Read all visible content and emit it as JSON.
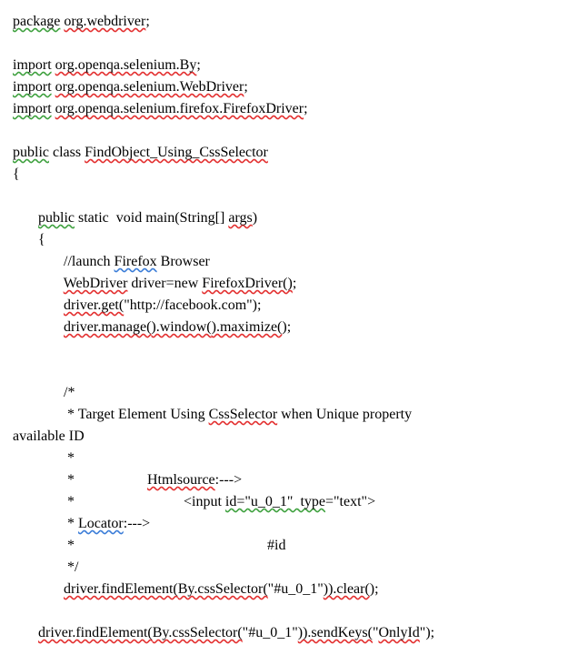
{
  "code": {
    "l1": {
      "a": "package",
      "b": " ",
      "c": "org.webdriver",
      "d": ";"
    },
    "l3": {
      "a": "import",
      "b": " ",
      "c": "org.openqa.selenium.By",
      "d": ";"
    },
    "l4": {
      "a": "import",
      "b": " ",
      "c": "org.openqa.selenium.WebDriver",
      "d": ";"
    },
    "l5": {
      "a": "import",
      "b": " ",
      "c": "org.openqa.selenium.firefox.FirefoxDriver",
      "d": ";"
    },
    "l7": {
      "a": "public",
      "b": " class ",
      "c": "FindObject_Using_CssSelector"
    },
    "l8": "{",
    "l10": {
      "a": "       ",
      "b": "public",
      "c": " static ",
      "c2": " void",
      "d": " main(String[] ",
      "e": "args",
      "f": ")"
    },
    "l11": "       {",
    "l12": {
      "a": "              //launch ",
      "b": "Firefox",
      "c": " Browser"
    },
    "l13": {
      "a": "              ",
      "b": "WebDriver",
      "c": " driver=new ",
      "d": "FirefoxDriver()",
      "e": ";"
    },
    "l14": {
      "a": "              ",
      "b": "driver.get(",
      "c": "\"http://facebook.com\"",
      "d": ");"
    },
    "l15": {
      "a": "              ",
      "b": "driver.manage(",
      "c": ").window(",
      "d": ").maximize(",
      "e": ");"
    },
    "l18": "              /*",
    "l19": {
      "a": "               * Target Element Using ",
      "b": "CssSelector",
      "c": " when Unique property"
    },
    "l20": "available ID",
    "l21": "               *",
    "l22": {
      "a": "               *                    ",
      "b": "Htmlsource",
      "c": ":--->"
    },
    "l23": {
      "a": "               *                              <input ",
      "b": "id=\"u_0_1\"  type",
      "c": "=\"text\">"
    },
    "l24": {
      "a": "               * ",
      "b": "Locator",
      "c": ":--->"
    },
    "l25": "               *                                                     #id",
    "l26": "               */",
    "l27": {
      "a": "              ",
      "b": "driver.findElement(",
      "c": "By.cssSelector(",
      "d": "\"#u_0_1\"",
      "e": ")).clear(",
      "f": ");"
    },
    "l29": {
      "a": "       ",
      "b": "driver.findElement(",
      "c": "By.cssSelector(",
      "d": "\"#u_0_1\"",
      "e": ")).sendKeys(",
      "f": "\"",
      "g": "OnlyId",
      "h": "\");"
    }
  }
}
